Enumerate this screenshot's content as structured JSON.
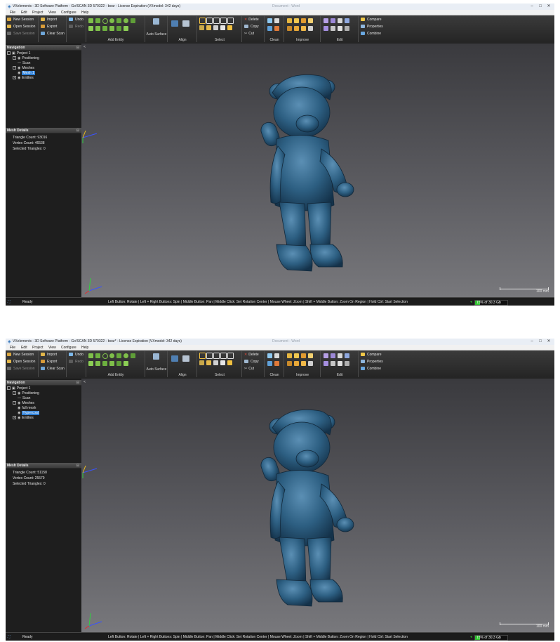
{
  "shots": [
    {
      "title": "VXelements - 3D Software Platform - Go!SCAN 3D 570322 - bear - License Expiration (VXmodel: 342 days)",
      "faded_title": "Document - Word",
      "navigation": {
        "header": "Navigation",
        "project": "Project 1",
        "positioning": "Positioning",
        "scan": "Scan",
        "meshes": "Meshes",
        "meshes_children": [
          "Mesh 1"
        ],
        "selected_child": 0,
        "entities": "Entities"
      },
      "mesh_details": {
        "header": "Mesh Details",
        "triangle_count": "Triangle Count: 93016",
        "vertex_count": "Vertex Count: 46538",
        "selected_triangles": "Selected Triangles: 0"
      }
    },
    {
      "title": "VXelements - 3D Software Platform - Go!SCAN 3D 570322 - bear* - License Expiration (VXmodel: 342 days)",
      "faded_title": "Document - Word",
      "navigation": {
        "header": "Navigation",
        "project": "Project 1",
        "positioning": "Positioning",
        "scan": "Scan",
        "meshes": "Meshes",
        "meshes_children": [
          "full mesh",
          "Hypercoat"
        ],
        "selected_child": 1,
        "entities": "Entities"
      },
      "mesh_details": {
        "header": "Mesh Details",
        "triangle_count": "Triangle Count: 51158",
        "vertex_count": "Vertex Count: 25579",
        "selected_triangles": "Selected Triangles: 0"
      }
    }
  ],
  "menu": [
    "File",
    "Edit",
    "Project",
    "View",
    "Configure",
    "Help"
  ],
  "ribbon": {
    "session": {
      "new": "New Session",
      "open": "Open Session",
      "save": "Save Session"
    },
    "file": {
      "import": "Import",
      "export": "Export",
      "clear": "Clear Scan"
    },
    "history": {
      "undo": "Undo",
      "redo": "Redo"
    },
    "groups": {
      "add_entity": "Add Entity",
      "auto_surface": "Auto Surface",
      "align": "Align",
      "select": "Select",
      "clean": "Clean",
      "improve": "Improve",
      "edit": "Edit"
    },
    "select_actions": {
      "delete": "Delete",
      "copy": "Copy",
      "cut": "Cut"
    },
    "tools": {
      "compare": "Compare",
      "properties": "Properties",
      "combine": "Combine"
    }
  },
  "viewport": {
    "scale_label": "100 mm",
    "corner": "<"
  },
  "status": {
    "state": "Ready",
    "hint": "Left Button: Rotate | Left + Right Buttons: Spin | Middle Button: Pan | Middle Click: Set Rotation Center | Mouse Wheel: Zoom | Shift + Middle Button: Zoom On Region | Hold Ctrl: Start Selection",
    "memory_percent": 15,
    "memory_label": "15% of 30.3 Gb"
  },
  "colors": {
    "mesh": "#2d5f82",
    "mesh_shadow": "#14324a",
    "selection": "#2e7fd6",
    "memory": "#2ec02e"
  }
}
